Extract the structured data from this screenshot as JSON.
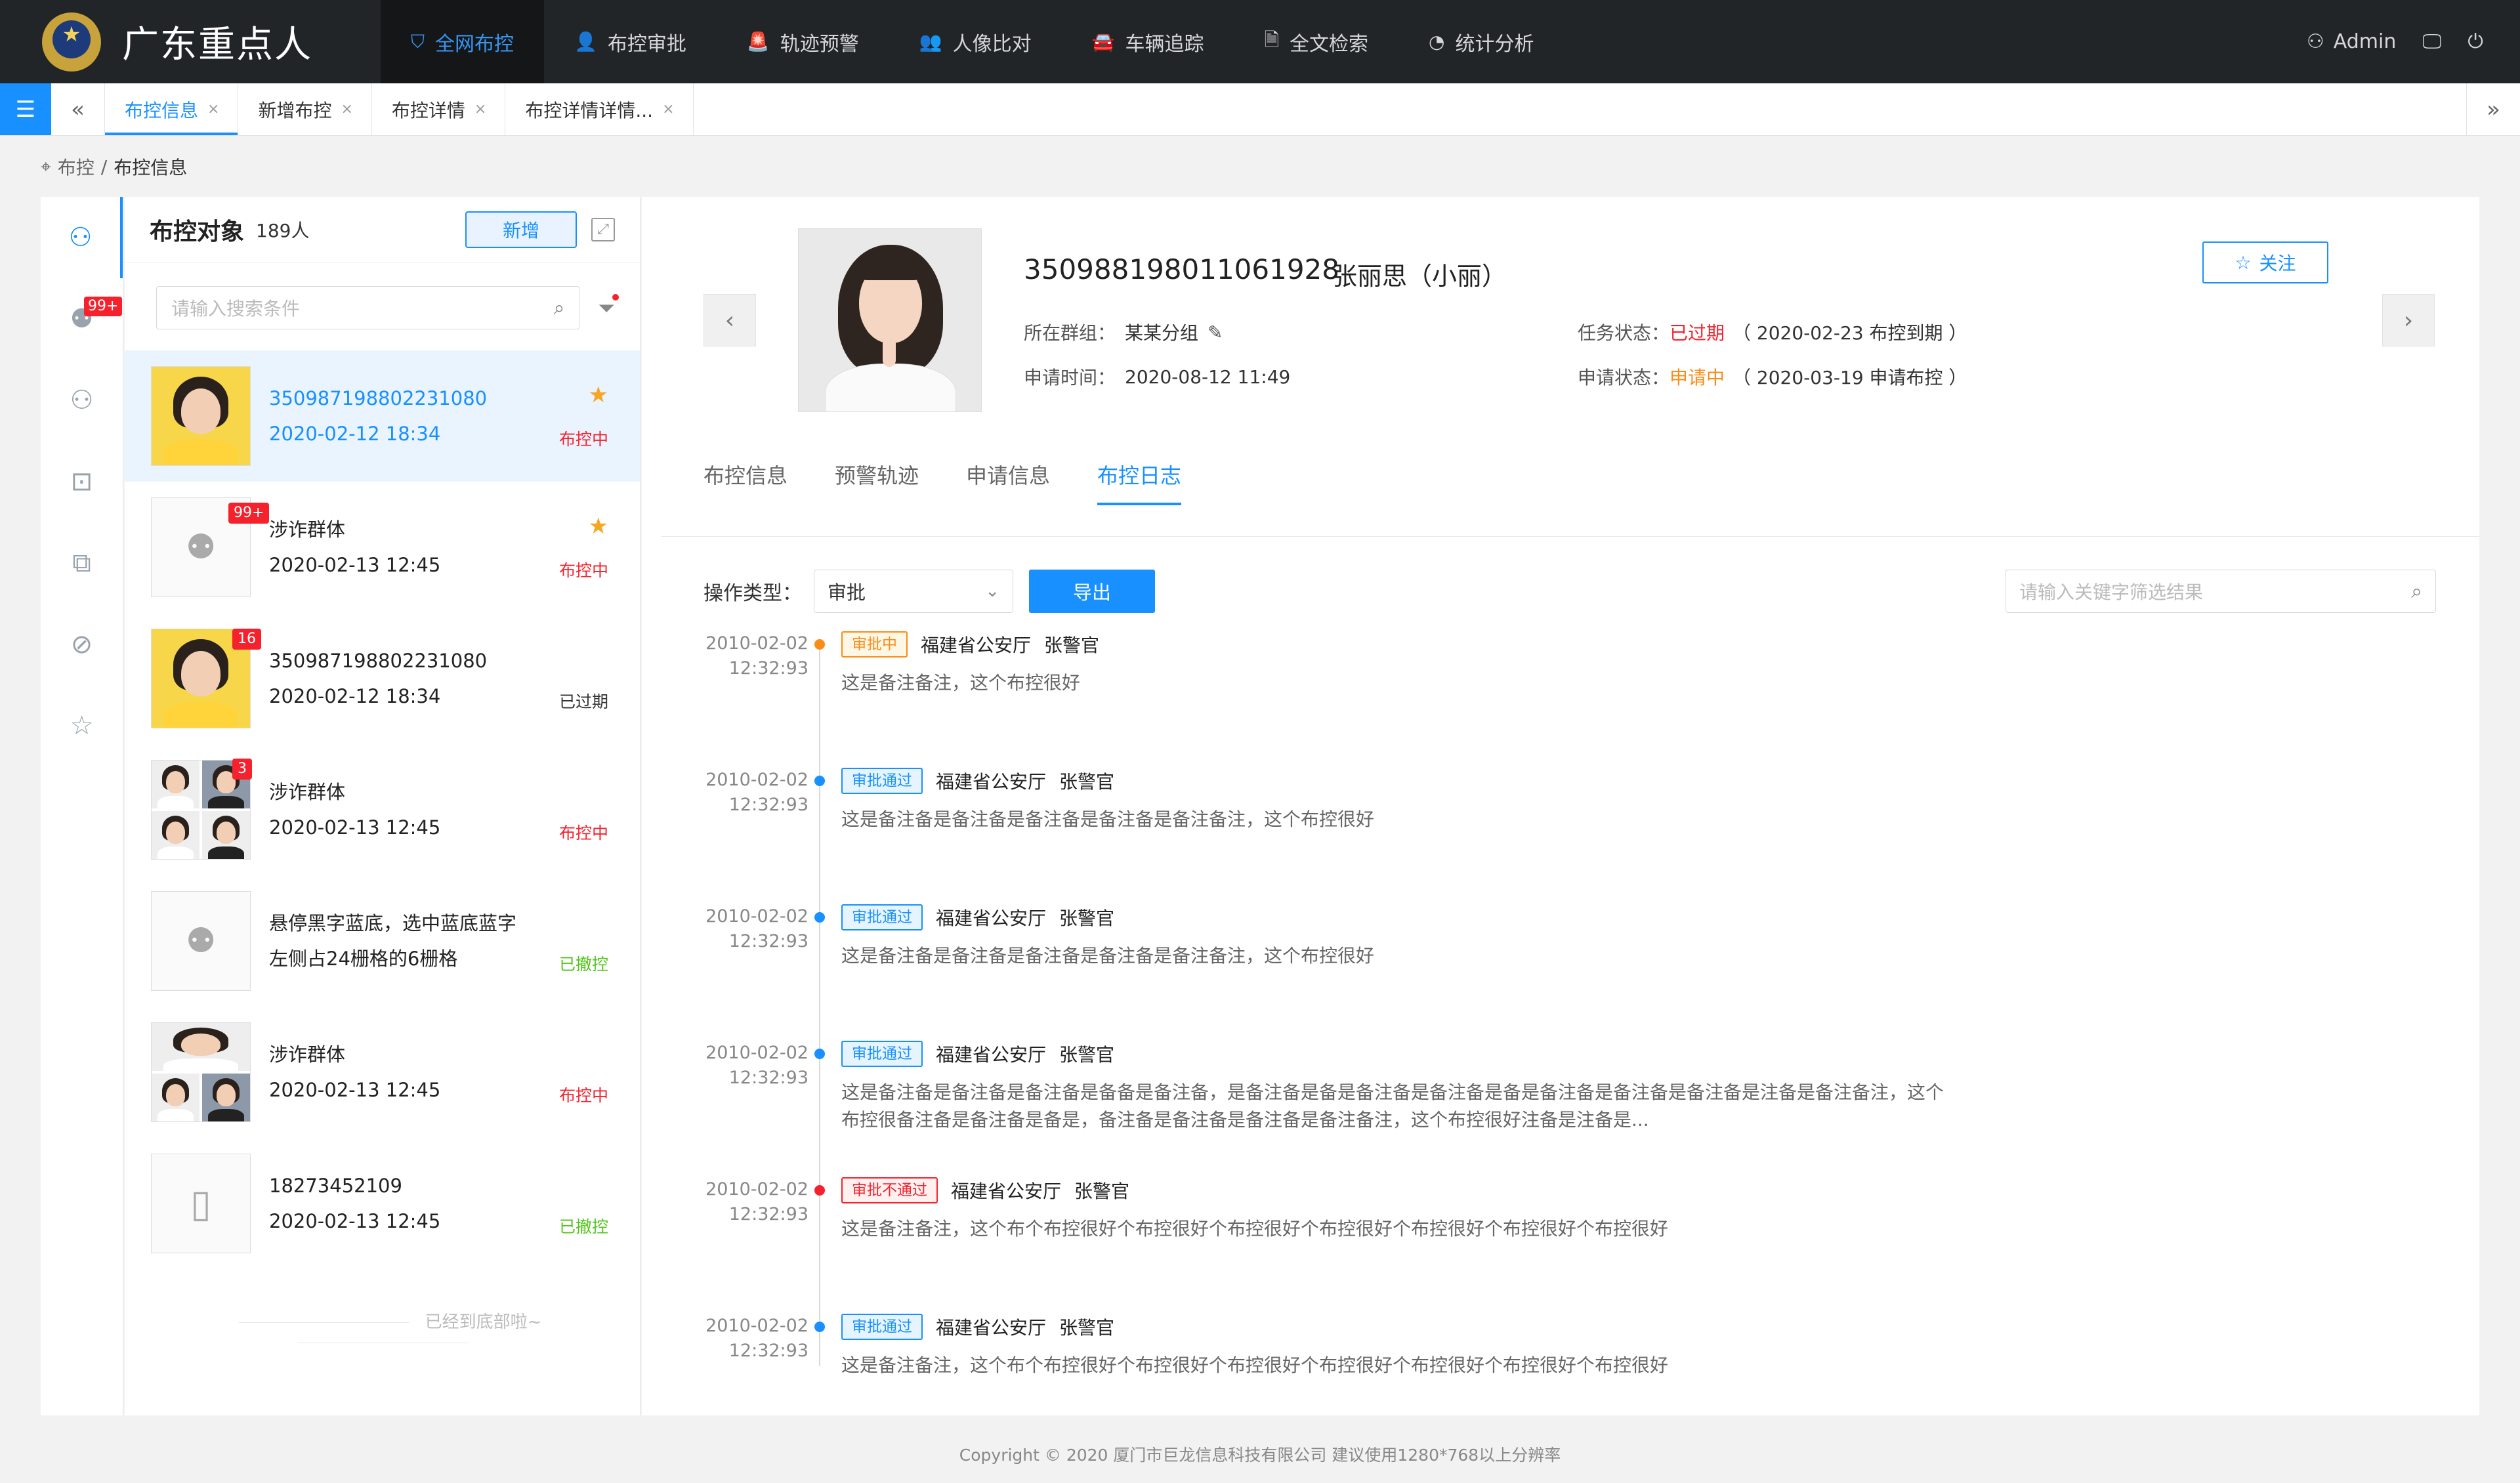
{
  "app": {
    "title": "广东重点人"
  },
  "topnav": {
    "items": [
      {
        "label": "全网布控",
        "icon": "shield-icon",
        "active": true
      },
      {
        "label": "布控审批",
        "icon": "user-icon"
      },
      {
        "label": "轨迹预警",
        "icon": "alarm-icon"
      },
      {
        "label": "人像比对",
        "icon": "face-icon"
      },
      {
        "label": "车辆追踪",
        "icon": "car-icon"
      },
      {
        "label": "全文检索",
        "icon": "doc-search-icon"
      },
      {
        "label": "统计分析",
        "icon": "pie-chart-icon"
      }
    ],
    "user": "Admin"
  },
  "tabs": [
    {
      "label": "布控信息",
      "active": true
    },
    {
      "label": "新增布控"
    },
    {
      "label": "布控详情"
    },
    {
      "label": "布控详情详情..."
    }
  ],
  "breadcrumb": {
    "parent": "布控",
    "sep": "/",
    "current": "布控信息"
  },
  "rail": {
    "badge": "99+"
  },
  "list": {
    "title": "布控对象",
    "count": "189人",
    "add_label": "新增",
    "search_placeholder": "请输入搜索条件",
    "items": [
      {
        "line1": "350987198802231080",
        "line2": "2020-02-12  18:34",
        "status": "布控中",
        "starred": true
      },
      {
        "line1": "涉诈群体",
        "line2": "2020-02-13  12:45",
        "status": "布控中",
        "starred": true,
        "badge": "99+"
      },
      {
        "line1": "350987198802231080",
        "line2": "2020-02-12  18:34",
        "status": "已过期",
        "badge": "16"
      },
      {
        "line1": "涉诈群体",
        "line2": "2020-02-13  12:45",
        "status": "布控中",
        "badge": "3"
      },
      {
        "line1": "悬停黑字蓝底，选中蓝底蓝字",
        "line2": "左侧占24栅格的6栅格",
        "status": "已撤控"
      },
      {
        "line1": "涉诈群体",
        "line2": "2020-02-13  12:45",
        "status": "布控中"
      },
      {
        "line1": "18273452109",
        "line2": "2020-02-13  12:45",
        "status": "已撤控"
      }
    ],
    "end_text": "已经到底部啦~"
  },
  "profile": {
    "id": "350988198011061928",
    "name": "张丽思（小丽）",
    "group_label": "所在群组：",
    "group_value": "某某分组",
    "apply_time_label": "申请时间：",
    "apply_time_value": "2020-08-12   11:49",
    "task_status_label": "任务状态：",
    "task_status_value": "已过期",
    "task_status_note": "（ 2020-02-23  布控到期 ）",
    "apply_status_label": "申请状态：",
    "apply_status_value": "申请中",
    "apply_status_note": "（ 2020-03-19  申请布控 ）",
    "follow_label": "关注"
  },
  "detail_tabs": [
    {
      "label": "布控信息"
    },
    {
      "label": "预警轨迹"
    },
    {
      "label": "申请信息"
    },
    {
      "label": "布控日志",
      "active": true
    }
  ],
  "filter": {
    "label": "操作类型：",
    "select_value": "审批",
    "export_label": "导出",
    "keyword_placeholder": "请输入关键字筛选结果"
  },
  "timeline": [
    {
      "date": "2010-02-02",
      "time": "12:32:93",
      "tag": "审批中",
      "tag_color": "orange",
      "org": "福建省公安厅",
      "officer": "张警官",
      "note": "这是备注备注，这个布控很好"
    },
    {
      "date": "2010-02-02",
      "time": "12:32:93",
      "tag": "审批通过",
      "tag_color": "blue",
      "org": "福建省公安厅",
      "officer": "张警官",
      "note": "这是备注备是备注备是备注备是备注备是备注备注，这个布控很好"
    },
    {
      "date": "2010-02-02",
      "time": "12:32:93",
      "tag": "审批通过",
      "tag_color": "blue",
      "org": "福建省公安厅",
      "officer": "张警官",
      "note": "这是备注备是备注备是备注备是备注备是备注备注，这个布控很好"
    },
    {
      "date": "2010-02-02",
      "time": "12:32:93",
      "tag": "审批通过",
      "tag_color": "blue",
      "org": "福建省公安厅",
      "officer": "张警官",
      "note": "这是备注备是备注备是备注备是备备是备注备，是备注备是备是备注备是备注备是备是备注备是备注备是备注备是注备是备注备注，这个布控很备注备是备注备是备是，备注备是备注备是备注备是备注备注，这个布控很好注备是注备是..."
    },
    {
      "date": "2010-02-02",
      "time": "12:32:93",
      "tag": "审批不通过",
      "tag_color": "red",
      "org": "福建省公安厅",
      "officer": "张警官",
      "note": "这是备注备注，这个布个布控很好个布控很好个布控很好个布控很好个布控很好个布控很好个布控很好"
    },
    {
      "date": "2010-02-02",
      "time": "12:32:93",
      "tag": "审批通过",
      "tag_color": "blue",
      "org": "福建省公安厅",
      "officer": "张警官",
      "note": "这是备注备注，这个布个布控很好个布控很好个布控很好个布控很好个布控很好个布控很好个布控很好"
    }
  ],
  "colors": {
    "primary": "#1890ff",
    "topbar": "#222528",
    "danger": "#f5222d",
    "warning": "#fa8c16",
    "success": "#52c41a",
    "star": "#f5a623"
  },
  "footer": "Copyright © 2020  厦门市巨龙信息科技有限公司  建议使用1280*768以上分辨率"
}
